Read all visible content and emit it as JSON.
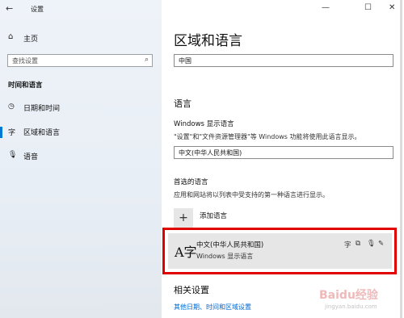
{
  "window": {
    "title": "设置",
    "back_icon": "back-arrow-icon",
    "minimize": "—",
    "maximize": "☐",
    "close": "✕"
  },
  "sidebar": {
    "home_label": "主页",
    "home_icon": "home-icon",
    "search_placeholder": "查找设置",
    "section_title": "时间和语言",
    "items": [
      {
        "label": "日期和时间",
        "icon": "calendar-clock-icon"
      },
      {
        "label": "区域和语言",
        "icon": "language-icon",
        "active": true
      },
      {
        "label": "语音",
        "icon": "microphone-icon"
      }
    ]
  },
  "main": {
    "title": "区域和语言",
    "region_value": "中国",
    "languages_heading": "语言",
    "display_language_label": "Windows 显示语言",
    "display_language_desc": "\"设置\"和\"文件资源管理器\"等 Windows 功能将使用此语言显示。",
    "display_language_value": "中文(中华人民共和国)",
    "preferred_label": "首选的语言",
    "preferred_desc": "应用和网站将以列表中受支持的第一种语言进行显示。",
    "add_language_label": "添加语言",
    "language_card": {
      "name": "中文(中华人民共和国)",
      "subtitle": "Windows 显示语言",
      "glyph": "A字"
    },
    "related_title": "相关设置",
    "related_link": "其他日期、时间和区域设置"
  },
  "watermark": {
    "text": "Baidu经验",
    "sub": "jingyan.baidu.com"
  },
  "colors": {
    "accent": "#0078d7",
    "highlight": "#e00000",
    "link": "#0066cc"
  }
}
